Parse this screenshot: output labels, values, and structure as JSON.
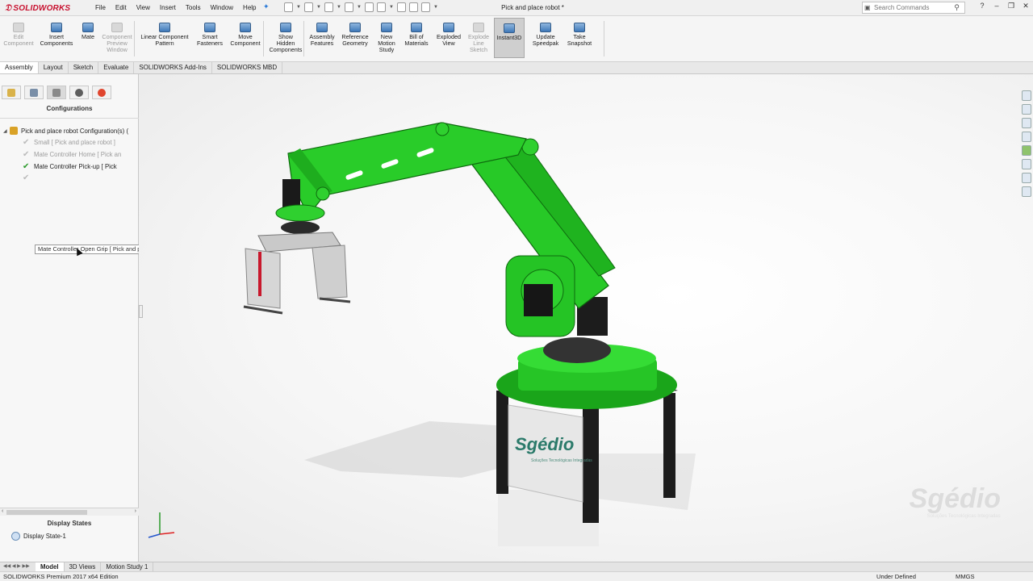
{
  "app": {
    "brand": "SOLIDWORKS",
    "document_title": "Pick and place robot *"
  },
  "menu": [
    "File",
    "Edit",
    "View",
    "Insert",
    "Tools",
    "Window",
    "Help"
  ],
  "search": {
    "placeholder": "Search Commands"
  },
  "ribbon": [
    {
      "id": "edit-component",
      "lines": [
        "Edit",
        "Component"
      ],
      "disabled": true
    },
    {
      "id": "insert-components",
      "lines": [
        "Insert",
        "Components"
      ],
      "disabled": false
    },
    {
      "id": "mate",
      "lines": [
        "Mate"
      ],
      "disabled": false
    },
    {
      "id": "component-preview-window",
      "lines": [
        "Component",
        "Preview",
        "Window"
      ],
      "disabled": true
    },
    {
      "id": "linear-component-pattern",
      "lines": [
        "Linear Component",
        "Pattern"
      ],
      "disabled": false
    },
    {
      "id": "smart-fasteners",
      "lines": [
        "Smart",
        "Fasteners"
      ],
      "disabled": false
    },
    {
      "id": "move-component",
      "lines": [
        "Move",
        "Component"
      ],
      "disabled": false
    },
    {
      "id": "show-hidden-components",
      "lines": [
        "Show",
        "Hidden",
        "Components"
      ],
      "disabled": false
    },
    {
      "id": "assembly-features",
      "lines": [
        "Assembly",
        "Features"
      ],
      "disabled": false
    },
    {
      "id": "reference-geometry",
      "lines": [
        "Reference",
        "Geometry"
      ],
      "disabled": false
    },
    {
      "id": "new-motion-study",
      "lines": [
        "New",
        "Motion",
        "Study"
      ],
      "disabled": false
    },
    {
      "id": "bill-of-materials",
      "lines": [
        "Bill of",
        "Materials"
      ],
      "disabled": false
    },
    {
      "id": "exploded-view",
      "lines": [
        "Exploded",
        "View"
      ],
      "disabled": false
    },
    {
      "id": "explode-line-sketch",
      "lines": [
        "Explode",
        "Line",
        "Sketch"
      ],
      "disabled": true
    },
    {
      "id": "instant3d",
      "lines": [
        "Instant3D"
      ],
      "disabled": false,
      "active": true
    },
    {
      "id": "update-speedpak",
      "lines": [
        "Update",
        "Speedpak"
      ],
      "disabled": false
    },
    {
      "id": "take-snapshot",
      "lines": [
        "Take",
        "Snapshot"
      ],
      "disabled": false
    }
  ],
  "tabs": [
    "Assembly",
    "Layout",
    "Sketch",
    "Evaluate",
    "SOLIDWORKS Add-Ins",
    "SOLIDWORKS MBD"
  ],
  "active_tab": "Assembly",
  "panel": {
    "configurations_heading": "Configurations",
    "root": "Pick and place robot Configuration(s)  (",
    "configs": [
      {
        "label": "Small [ Pick and place robot ]",
        "state": "inactive"
      },
      {
        "label": "Mate Controller Home [ Pick an",
        "state": "inactive"
      },
      {
        "label": "Mate Controller Pick-up [ Pick",
        "state": "active"
      },
      {
        "label": "Mate Controller Open Grip [ Pick and place robot ]",
        "state": "hover"
      }
    ],
    "tooltip": "Mate Controller Open Grip [ Pick and place robot ]",
    "display_states_heading": "Display States",
    "display_state": "Display State-1"
  },
  "viewport": {
    "watermark": "Sgédio",
    "watermark_sub": "Soluções Tecnológicas Integradas",
    "panel_brand": "Sgédio",
    "panel_brand_sub": "Soluções Tecnológicas Integradas",
    "robot_color": "#2bd02b"
  },
  "bottom_tabs": [
    "Model",
    "3D Views",
    "Motion Study 1"
  ],
  "active_bottom_tab": "Model",
  "status": {
    "edition": "SOLIDWORKS Premium 2017 x64 Edition",
    "state": "Under Defined",
    "units": "MMGS"
  }
}
